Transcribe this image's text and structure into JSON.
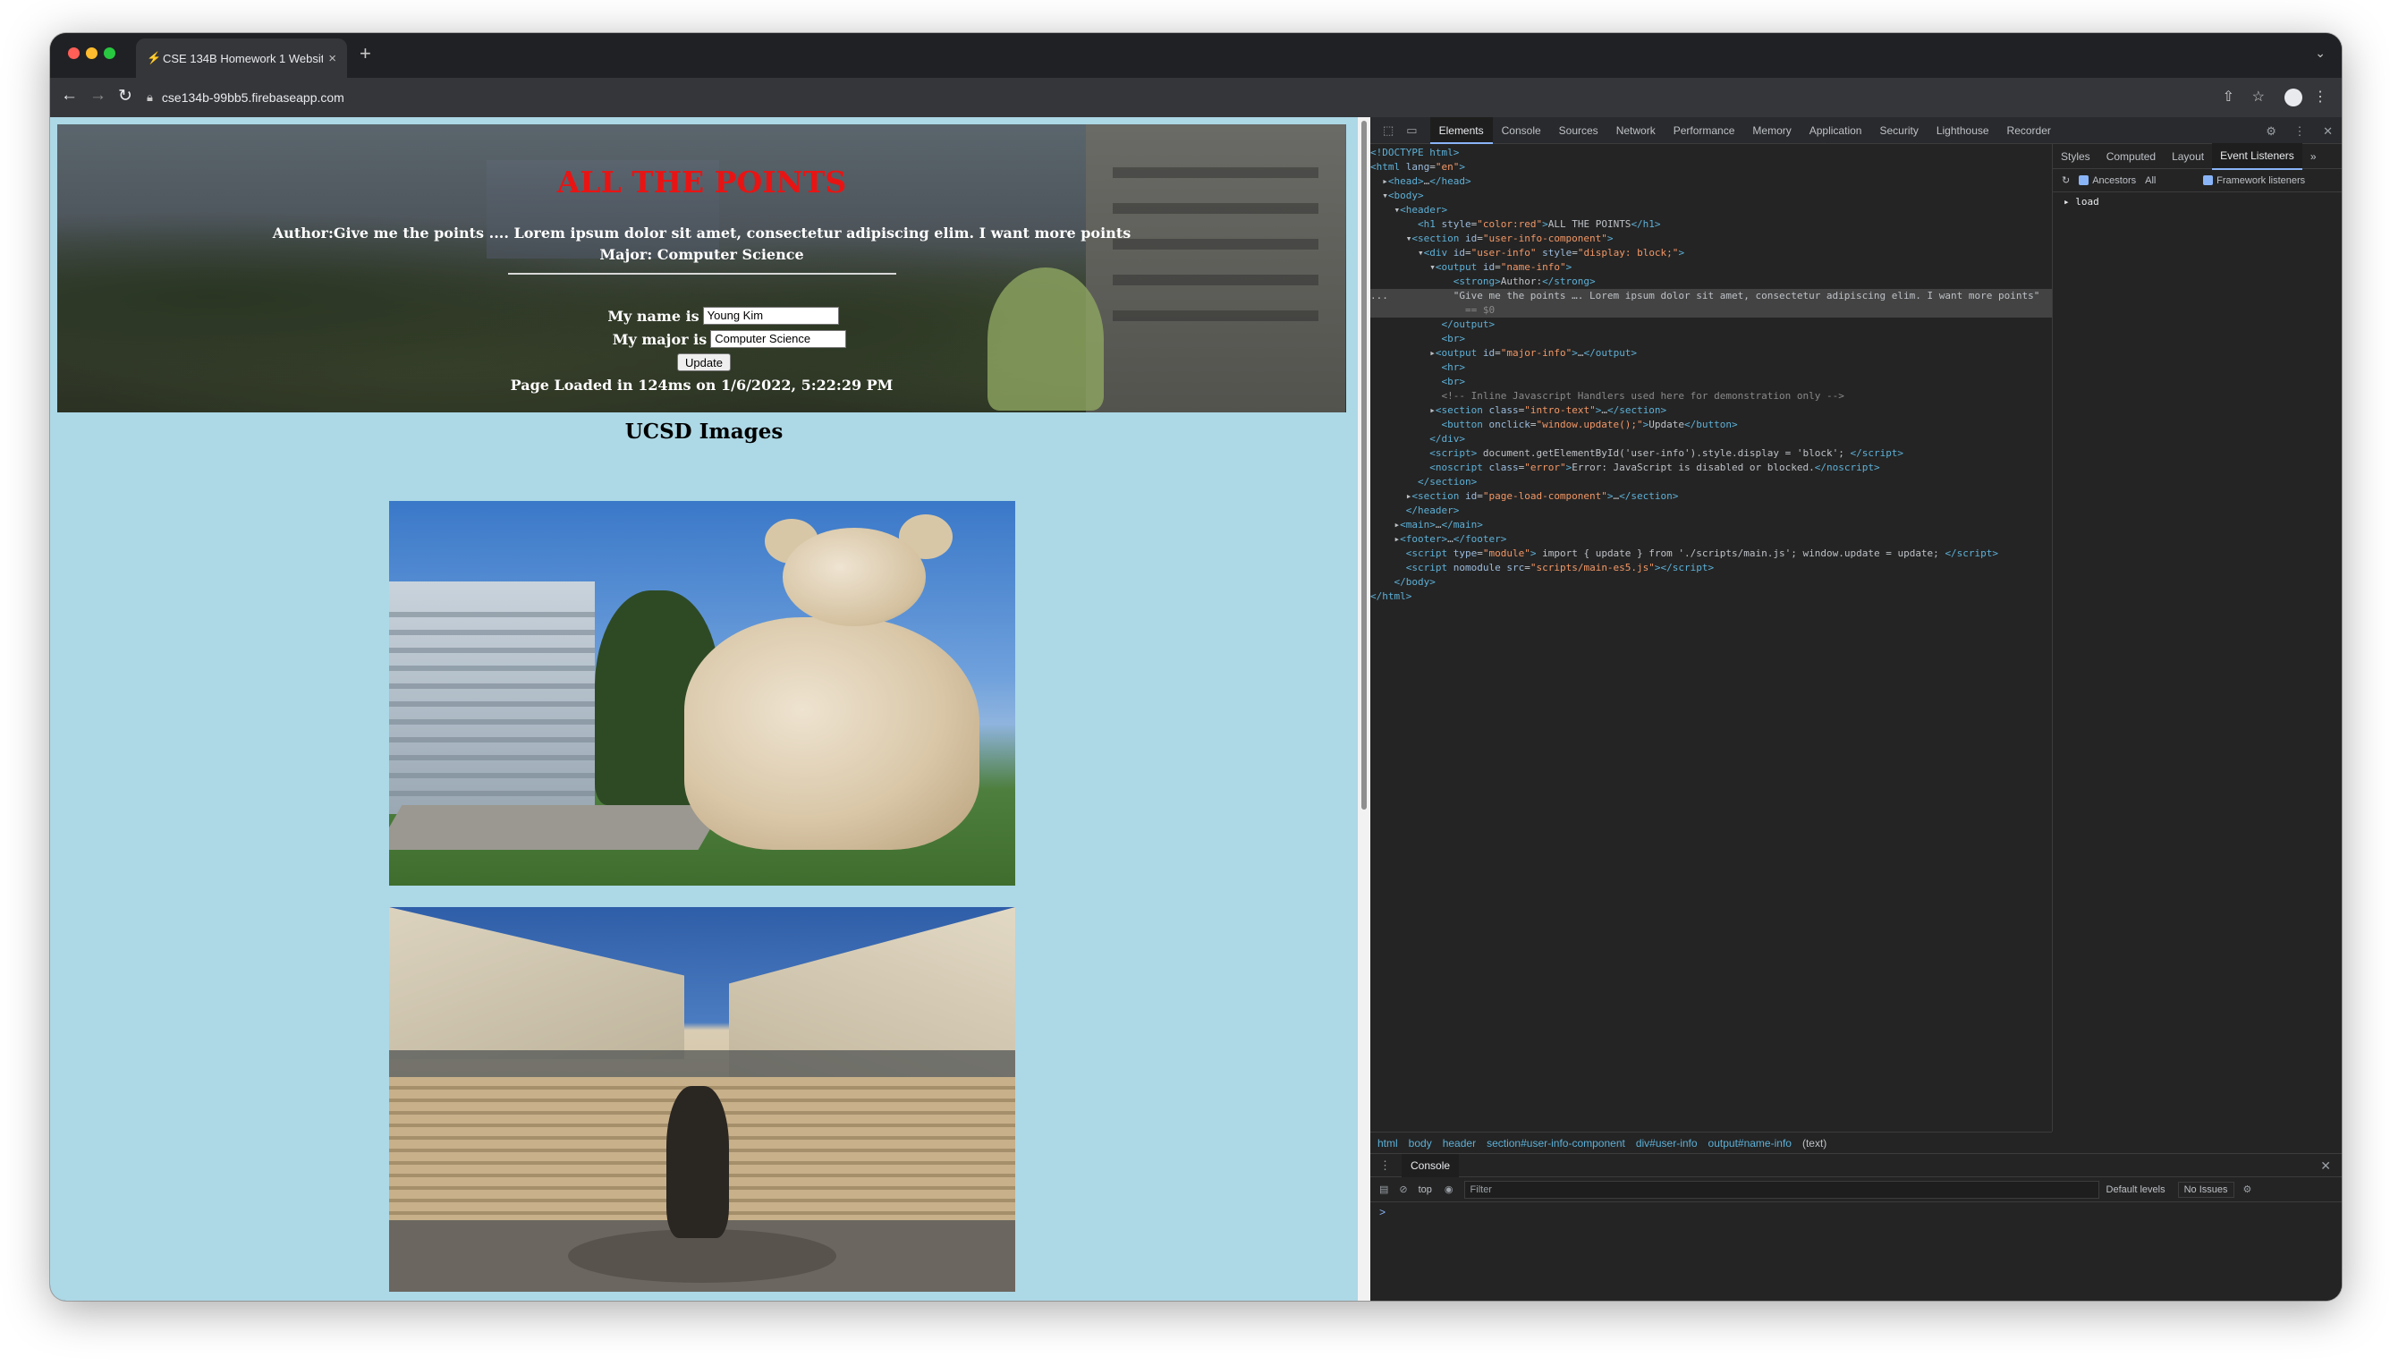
{
  "browser": {
    "tab_title": "CSE 134B Homework 1 Websit",
    "url": "cse134b-99bb5.firebaseapp.com"
  },
  "page": {
    "heading": "ALL THE POINTS",
    "author_line": "Author:Give me the points .... Lorem ipsum dolor sit amet, consectetur adipiscing elim. I want more points",
    "major_line": "Major: Computer Science",
    "name_label": "My name is",
    "name_value": "Young Kim",
    "major_label": "My major is",
    "major_value": "Computer Science",
    "update_label": "Update",
    "page_loaded": "Page Loaded in 124ms on 1/6/2022, 5:22:29 PM",
    "images_title": "UCSD Images"
  },
  "devtools": {
    "tabs": [
      "Elements",
      "Console",
      "Sources",
      "Network",
      "Performance",
      "Memory",
      "Application",
      "Security",
      "Lighthouse",
      "Recorder"
    ],
    "active_tab": "Elements",
    "side_tabs": [
      "Styles",
      "Computed",
      "Layout",
      "Event Listeners"
    ],
    "active_side_tab": "Event Listeners",
    "ancestors_label": "Ancestors",
    "ancestors_select": "All",
    "framework_label": "Framework listeners",
    "listener": "load",
    "breadcrumbs": [
      "html",
      "body",
      "header",
      "section#user-info-component",
      "div#user-info",
      "output#name-info",
      "(text)"
    ],
    "drawer_tab": "Console",
    "context": "top",
    "filter_placeholder": "Filter",
    "levels": "Default levels",
    "issues": "No Issues",
    "prompt": ">"
  }
}
